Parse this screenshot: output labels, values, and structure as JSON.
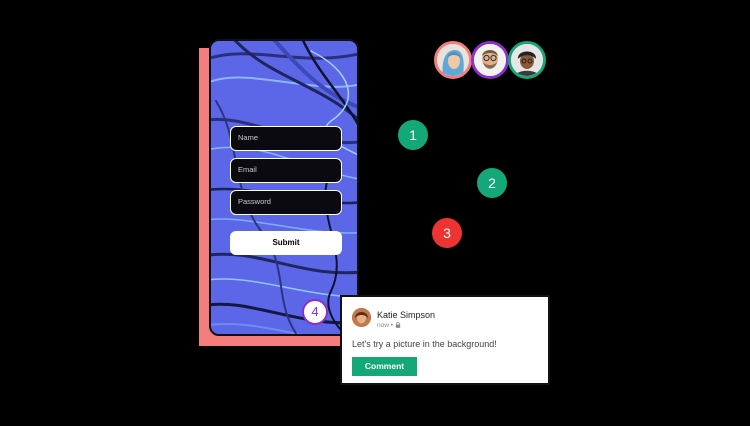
{
  "form": {
    "name_placeholder": "Name",
    "email_placeholder": "Email",
    "password_placeholder": "Password",
    "submit_label": "Submit"
  },
  "steps": [
    "1",
    "2",
    "3",
    "4"
  ],
  "colors": {
    "background": "#000000",
    "phone_shadow": "#f47c7c",
    "step_green": "#14a878",
    "step_red": "#ee3333",
    "step4_purple": "#8b2fc9",
    "comment_green": "#14a878",
    "avatar_ring_salmon": "#f47c7c",
    "avatar_ring_purple": "#8b2fc9",
    "avatar_ring_green": "#14a878"
  },
  "avatars": [
    "avatar-woman-blue-hair",
    "avatar-man-glasses-beard",
    "avatar-man-curly-hair"
  ],
  "post": {
    "author": "Katie Simpson",
    "time": "now",
    "separator": "•",
    "privacy_icon": "lock-icon",
    "text": "Let's try a picture in the background!",
    "comment_label": "Comment"
  }
}
